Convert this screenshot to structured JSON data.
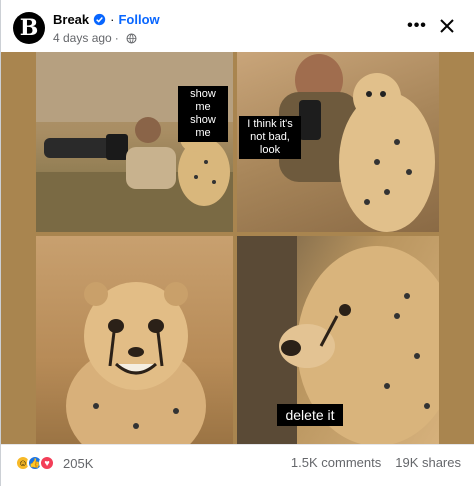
{
  "post": {
    "author": "Break",
    "follow_label": "Follow",
    "separator": "·",
    "time": "4 days ago",
    "avatar_letter": "B"
  },
  "header_actions": {
    "more_label": "•••",
    "close_label": "Close"
  },
  "meme": {
    "caption_1": "show me show me",
    "caption_2": "I think it's not bad, look",
    "caption_3": "delete it"
  },
  "footer": {
    "reaction_count": "205K",
    "comments": "1.5K comments",
    "shares": "19K shares",
    "reaction_icons": [
      "haha-icon",
      "like-icon",
      "love-icon"
    ]
  },
  "colors": {
    "follow": "#0866ff",
    "verified": "#0866ff",
    "like": "#1b74e4",
    "love": "#f33e58",
    "haha": "#f7b928"
  }
}
